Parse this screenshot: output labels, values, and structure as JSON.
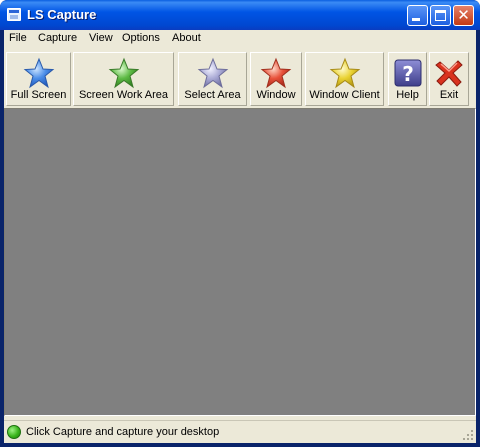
{
  "window": {
    "title": "LS Capture",
    "icon": "app-window-icon"
  },
  "menu": {
    "items": [
      "File",
      "Capture",
      "View",
      "Options",
      "About"
    ]
  },
  "toolbar": {
    "buttons": [
      {
        "label": "Full Screen",
        "icon": "blue-star-icon",
        "color": "#4A8DE8"
      },
      {
        "label": "Screen Work Area",
        "icon": "green-star-icon",
        "color": "#5DBA44"
      },
      {
        "label": "Select Area",
        "icon": "lavender-star-icon",
        "color": "#9C9CCB"
      },
      {
        "label": "Window",
        "icon": "red-star-icon",
        "color": "#E8513A"
      },
      {
        "label": "Window Client",
        "icon": "yellow-star-icon",
        "color": "#E9D232"
      },
      {
        "label": "Help",
        "icon": "question-mark-icon",
        "color": "#5959A8"
      },
      {
        "label": "Exit",
        "icon": "red-x-icon",
        "color": "#D9321E"
      }
    ]
  },
  "status": {
    "text": "Click Capture and capture your desktop",
    "indicator_color": "#3AB51C"
  },
  "colors": {
    "titlebar": "#0055E5",
    "client_bg": "#ECE9D8",
    "canvas_bg": "#808080"
  }
}
